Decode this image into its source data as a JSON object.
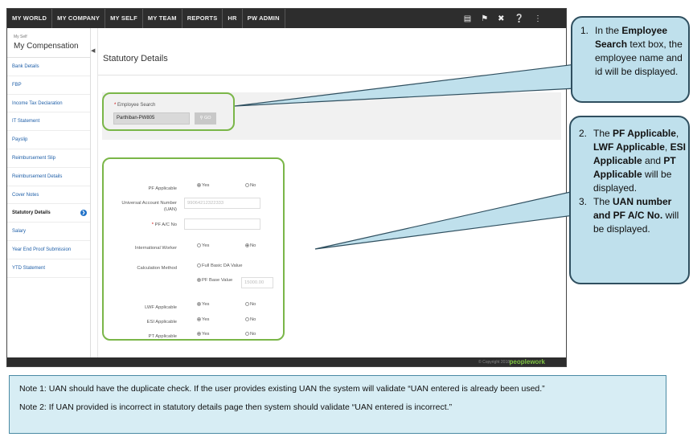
{
  "topnav": {
    "items": [
      "MY WORLD",
      "MY COMPANY",
      "MY SELF",
      "MY TEAM",
      "REPORTS",
      "HR",
      "PW ADMIN"
    ]
  },
  "sidebar": {
    "pre_title": "My Self",
    "title": "My Compensation",
    "items": [
      "Bank Details",
      "FBP",
      "Income Tax Declaration",
      "IT Statement",
      "Payslip",
      "Reimbursement Slip",
      "Reimbursement Details",
      "Cover Notes",
      "Statutory Details",
      "Salary",
      "Year End Proof Submission",
      "YTD Statement"
    ]
  },
  "main": {
    "page_title": "Statutory Details",
    "search": {
      "label": "Employee Search",
      "value": "Parthiban-PW805",
      "go": "GO"
    },
    "form": {
      "pf_applicable": "PF Applicable",
      "uan_label_1": "Universal Account Number",
      "uan_label_2": "(UAN)",
      "uan_value": "99064212322333",
      "pf_ac_no": "PF A/C No",
      "international_worker": "International Worker",
      "calculation_method": "Calculation Method",
      "full_basic_da": "Full Basic DA Value",
      "pf_base_value": "PF Base Value",
      "pf_base_amount": "15000.00",
      "lwf_applicable": "LWF Applicable",
      "esi_applicable": "ESI Applicable",
      "pt_applicable": "PT Applicable",
      "yes": "Yes",
      "no": "No"
    }
  },
  "footer": {
    "copyright": "© Copyright 2018",
    "brand": "peoplework"
  },
  "callout1": {
    "num": "1.",
    "t1": "In the ",
    "b1": "Employee Search",
    "t2": " text box, the employee name and id will be displayed."
  },
  "callout2": {
    "num2": "2.",
    "t_the": "The ",
    "b_pf": "PF Applicable",
    "comma1": ",",
    "b_lwf": "LWF Applicable",
    "comma2": ",",
    "b_esi": "ESI Applicable",
    "t_and": " and ",
    "b_pt": "PT Applicable",
    "t_disp": " will be displayed.",
    "num3": "3.",
    "t_the3": "The ",
    "b_uan": "UAN number and PF A/C No.",
    "t_disp3": " will be displayed."
  },
  "notes": {
    "note1": "Note 1: UAN should have the duplicate check. If the user provides existing UAN the system will validate “UAN entered is already been used.”",
    "note2": "Note 2: If UAN provided is incorrect in statutory details page then system should validate “UAN entered is incorrect.”"
  }
}
